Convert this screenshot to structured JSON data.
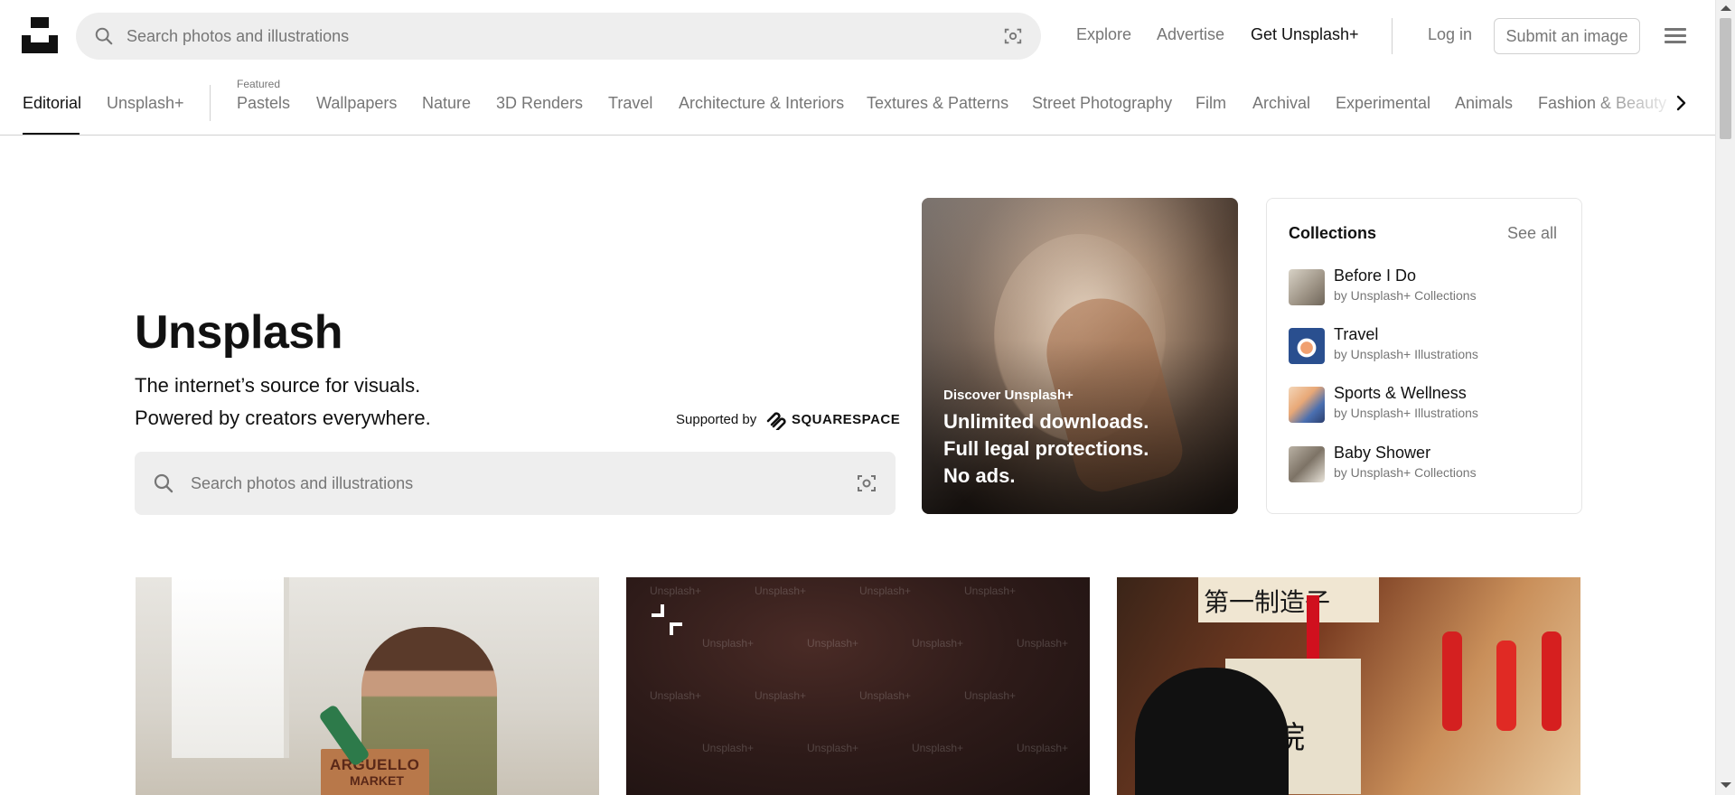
{
  "header": {
    "search_placeholder": "Search photos and illustrations",
    "nav": {
      "explore": "Explore",
      "advertise": "Advertise",
      "get_plus": "Get Unsplash+"
    },
    "login": "Log in",
    "submit": "Submit an image"
  },
  "categories": {
    "editorial": "Editorial",
    "unsplash_plus": "Unsplash+",
    "featured_label": "Featured",
    "items": [
      "Pastels",
      "Wallpapers",
      "Nature",
      "3D Renders",
      "Travel",
      "Architecture & Interiors",
      "Textures & Patterns",
      "Street Photography",
      "Film",
      "Archival",
      "Experimental",
      "Animals",
      "Fashion & Beauty"
    ]
  },
  "hero": {
    "title": "Unsplash",
    "subtitle_line1": "The internet’s source for visuals.",
    "subtitle_line2": "Powered by creators everywhere.",
    "supported_by": "Supported by",
    "sponsor": "SQUARESPACE",
    "search_placeholder": "Search photos and illustrations"
  },
  "promo": {
    "kicker": "Discover Unsplash+",
    "line1": "Unlimited downloads.",
    "line2": "Full legal protections.",
    "line3": "No ads."
  },
  "collections": {
    "title": "Collections",
    "see_all": "See all",
    "items": [
      {
        "name": "Before I Do",
        "by": "by Unsplash+ Collections"
      },
      {
        "name": "Travel",
        "by": "by Unsplash+ Illustrations"
      },
      {
        "name": "Sports & Wellness",
        "by": "by Unsplash+ Illustrations"
      },
      {
        "name": "Baby Shower",
        "by": "by Unsplash+ Collections"
      }
    ]
  },
  "photos": {
    "bag_text_line1": "ARGUELLO",
    "bag_text_line2": "MARKET",
    "watermark": "Unsplash+",
    "sign_text": "第一制造子",
    "shop_sign": "景院"
  },
  "colors": {
    "text_primary": "#111111",
    "text_secondary": "#767676",
    "search_bg": "#eeeeee",
    "border": "#d1d1d1"
  }
}
